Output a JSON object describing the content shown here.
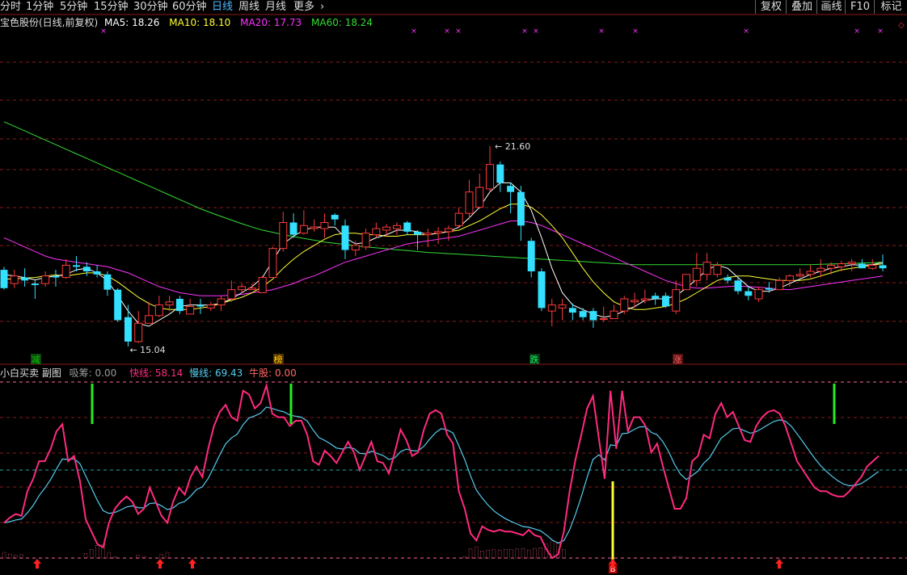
{
  "toolbar": {
    "timeframes": [
      "分时",
      "1分钟",
      "5分钟",
      "15分钟",
      "30分钟",
      "60分钟",
      "日线",
      "周线",
      "月线",
      "更多"
    ],
    "active_timeframe": "日线",
    "more_arrow": "›",
    "right_buttons": [
      "复权",
      "叠加",
      "画线",
      "F10",
      "标记"
    ]
  },
  "ma_header": {
    "name": "宝色股份(日线,前复权)",
    "ma5": "MA5: 18.26",
    "ma10": "MA10: 18.10",
    "ma20": "MA20: 17.73",
    "ma60": "MA60: 18.24"
  },
  "colors": {
    "up": "#ff3b3b",
    "down": "#33e0ff",
    "ma5": "#ffffff",
    "ma10": "#ffff33",
    "ma20": "#ff33ff",
    "ma60": "#33dd33",
    "fast": "#ff2a7f",
    "slow": "#55ccee",
    "grid": "#8b1a1a"
  },
  "price_labels": {
    "high": "21.60",
    "low": "15.04"
  },
  "signals": [
    {
      "text": "减",
      "color": "#00cc00",
      "bg": "#114411",
      "pos": 44
    },
    {
      "text": "榜",
      "color": "#ffcc00",
      "bg": "#553300",
      "pos": 344
    },
    {
      "text": "跌",
      "color": "#00ff66",
      "bg": "#113311",
      "pos": 661
    },
    {
      "text": "涨",
      "color": "#ff6666",
      "bg": "#551111",
      "pos": 838
    }
  ],
  "indicator_header": {
    "name": "小白买卖 副图",
    "suck": "吸筹: 0.00",
    "fast": "快线: 58.14",
    "slow": "慢线: 69.43",
    "bull": "牛股: 0.00"
  },
  "buy_marker": "B",
  "chart_data": {
    "type": "candlestick",
    "candles": [
      [
        17.55,
        16.95,
        17.65,
        16.9
      ],
      [
        17.1,
        17.35,
        17.55,
        16.95
      ],
      [
        17.3,
        17.2,
        17.6,
        17.0
      ],
      [
        17.1,
        17.05,
        17.2,
        16.6
      ],
      [
        17.1,
        17.35,
        17.5,
        17.0
      ],
      [
        17.35,
        17.3,
        17.55,
        17.0
      ],
      [
        17.3,
        17.7,
        17.9,
        17.25
      ],
      [
        17.7,
        17.65,
        18.0,
        17.5
      ],
      [
        17.65,
        17.5,
        17.8,
        17.35
      ],
      [
        17.5,
        17.4,
        17.7,
        17.3
      ],
      [
        17.4,
        16.9,
        17.5,
        16.7
      ],
      [
        16.9,
        15.9,
        16.95,
        15.85
      ],
      [
        16.0,
        15.2,
        16.4,
        15.04
      ],
      [
        15.2,
        15.8,
        16.2,
        15.15
      ],
      [
        15.8,
        16.05,
        16.5,
        15.8
      ],
      [
        16.05,
        16.4,
        16.7,
        16.0
      ],
      [
        16.4,
        16.5,
        16.7,
        16.2
      ],
      [
        16.6,
        16.2,
        16.7,
        16.1
      ],
      [
        16.1,
        16.35,
        16.6,
        16.1
      ],
      [
        16.4,
        16.35,
        16.6,
        16.1
      ],
      [
        16.3,
        16.4,
        16.5,
        16.2
      ],
      [
        16.4,
        16.6,
        16.7,
        16.2
      ],
      [
        16.6,
        16.9,
        17.2,
        16.5
      ],
      [
        16.9,
        17.0,
        17.1,
        16.8
      ],
      [
        16.9,
        16.95,
        17.1,
        16.9
      ],
      [
        16.8,
        17.3,
        17.35,
        16.8
      ],
      [
        17.3,
        18.25,
        18.3,
        17.3
      ],
      [
        18.25,
        19.1,
        19.45,
        18.15
      ],
      [
        19.1,
        18.7,
        19.4,
        18.6
      ],
      [
        18.75,
        19.0,
        19.5,
        18.7
      ],
      [
        18.9,
        18.95,
        19.2,
        18.8
      ],
      [
        18.9,
        19.1,
        19.4,
        18.6
      ],
      [
        19.35,
        19.2,
        19.4,
        19.0
      ],
      [
        19.0,
        18.2,
        19.2,
        17.9
      ],
      [
        18.2,
        18.35,
        18.5,
        18.0
      ],
      [
        18.3,
        18.75,
        18.9,
        18.2
      ],
      [
        18.7,
        18.9,
        19.1,
        18.6
      ],
      [
        18.85,
        18.95,
        19.05,
        18.65
      ],
      [
        18.9,
        19.0,
        19.1,
        18.7
      ],
      [
        19.1,
        18.8,
        19.15,
        18.7
      ],
      [
        18.8,
        18.7,
        18.85,
        18.2
      ],
      [
        18.7,
        18.75,
        18.9,
        18.3
      ],
      [
        18.75,
        18.8,
        18.95,
        18.4
      ],
      [
        18.8,
        18.9,
        19.0,
        18.5
      ],
      [
        19.0,
        19.4,
        19.6,
        18.95
      ],
      [
        19.4,
        20.1,
        20.5,
        19.2
      ],
      [
        19.6,
        20.25,
        20.7,
        19.55
      ],
      [
        20.2,
        21.0,
        21.6,
        20.1
      ],
      [
        21.0,
        20.4,
        21.1,
        20.1
      ],
      [
        20.3,
        20.1,
        20.4,
        19.4
      ],
      [
        20.1,
        19.0,
        20.3,
        18.5
      ],
      [
        18.5,
        17.5,
        18.6,
        17.3
      ],
      [
        17.5,
        16.3,
        17.6,
        16.2
      ],
      [
        16.2,
        16.4,
        16.6,
        15.7
      ],
      [
        16.3,
        16.4,
        16.6,
        15.9
      ],
      [
        16.3,
        16.15,
        16.45,
        15.9
      ],
      [
        16.2,
        16.0,
        16.3,
        15.9
      ],
      [
        16.2,
        15.9,
        16.3,
        15.65
      ],
      [
        15.95,
        15.95,
        16.35,
        15.85
      ],
      [
        15.95,
        16.2,
        16.4,
        15.95
      ],
      [
        16.2,
        16.6,
        16.7,
        16.1
      ],
      [
        16.5,
        16.55,
        16.8,
        16.3
      ],
      [
        16.55,
        16.6,
        16.9,
        16.45
      ],
      [
        16.7,
        16.6,
        16.8,
        16.4
      ],
      [
        16.7,
        16.35,
        16.8,
        16.3
      ],
      [
        16.2,
        16.9,
        17.2,
        16.1
      ],
      [
        16.9,
        17.4,
        17.4,
        16.9
      ],
      [
        17.2,
        17.6,
        18.1,
        17.0
      ],
      [
        17.4,
        17.8,
        18.1,
        17.2
      ],
      [
        17.4,
        17.7,
        17.8,
        17.3
      ],
      [
        17.3,
        17.2,
        17.4,
        17.1
      ],
      [
        17.2,
        16.85,
        17.3,
        16.75
      ],
      [
        16.85,
        16.7,
        17.0,
        16.55
      ],
      [
        16.6,
        16.9,
        17.0,
        16.5
      ],
      [
        16.95,
        16.9,
        17.15,
        16.8
      ],
      [
        16.9,
        17.2,
        17.3,
        16.9
      ],
      [
        17.2,
        17.35,
        17.4,
        17.0
      ],
      [
        17.35,
        17.4,
        17.6,
        17.3
      ],
      [
        17.4,
        17.5,
        17.7,
        17.3
      ],
      [
        17.5,
        17.6,
        17.9,
        17.3
      ],
      [
        17.6,
        17.7,
        17.8,
        17.4
      ],
      [
        17.65,
        17.75,
        17.85,
        17.5
      ],
      [
        17.75,
        17.8,
        17.9,
        17.5
      ],
      [
        17.75,
        17.6,
        17.9,
        17.6
      ],
      [
        17.6,
        17.7,
        17.9,
        17.55
      ],
      [
        17.7,
        17.6,
        18.05,
        17.5
      ]
    ],
    "ma5": [
      17.4,
      17.35,
      17.3,
      17.22,
      17.3,
      17.35,
      17.4,
      17.55,
      17.6,
      17.45,
      17.2,
      16.7,
      16.2,
      15.8,
      15.7,
      15.9,
      16.1,
      16.35,
      16.4,
      16.4,
      16.4,
      16.45,
      16.6,
      16.8,
      17.0,
      17.3,
      17.85,
      18.4,
      18.65,
      18.85,
      18.95,
      18.95,
      18.95,
      18.6,
      18.4,
      18.45,
      18.6,
      18.7,
      18.85,
      18.85,
      18.8,
      18.7,
      18.75,
      18.8,
      18.95,
      19.25,
      19.6,
      20.1,
      20.4,
      20.4,
      20.1,
      19.5,
      18.6,
      17.6,
      16.8,
      16.4,
      16.25,
      16.1,
      16.0,
      16.05,
      16.2,
      16.35,
      16.55,
      16.6,
      16.6,
      16.7,
      16.95,
      17.25,
      17.55,
      17.7,
      17.6,
      17.3,
      17.0,
      16.85,
      16.85,
      16.95,
      17.1,
      17.25,
      17.4,
      17.5,
      17.6,
      17.65,
      17.72,
      17.7,
      17.72,
      17.8
    ],
    "ma10": [
      17.25,
      17.25,
      17.28,
      17.3,
      17.35,
      17.38,
      17.35,
      17.4,
      17.45,
      17.45,
      17.35,
      17.15,
      16.9,
      16.65,
      16.45,
      16.3,
      16.25,
      16.25,
      16.25,
      16.3,
      16.35,
      16.45,
      16.55,
      16.65,
      16.8,
      17.0,
      17.25,
      17.6,
      17.9,
      18.15,
      18.35,
      18.55,
      18.7,
      18.75,
      18.75,
      18.7,
      18.7,
      18.65,
      18.65,
      18.7,
      18.7,
      18.7,
      18.75,
      18.8,
      18.85,
      19.0,
      19.15,
      19.35,
      19.55,
      19.7,
      19.7,
      19.6,
      19.35,
      19.0,
      18.6,
      18.1,
      17.6,
      17.15,
      16.8,
      16.5,
      16.35,
      16.25,
      16.25,
      16.3,
      16.35,
      16.45,
      16.6,
      16.8,
      17.0,
      17.2,
      17.3,
      17.35,
      17.35,
      17.3,
      17.25,
      17.2,
      17.2,
      17.2,
      17.25,
      17.35,
      17.45,
      17.55,
      17.6,
      17.65,
      17.7,
      17.75
    ],
    "ma20": [
      18.6,
      18.45,
      18.3,
      18.15,
      18.0,
      17.9,
      17.85,
      17.8,
      17.75,
      17.7,
      17.65,
      17.55,
      17.45,
      17.3,
      17.15,
      17.0,
      16.9,
      16.8,
      16.75,
      16.7,
      16.7,
      16.7,
      16.72,
      16.75,
      16.8,
      16.85,
      16.9,
      17.0,
      17.1,
      17.25,
      17.35,
      17.5,
      17.65,
      17.8,
      17.9,
      18.0,
      18.1,
      18.2,
      18.3,
      18.4,
      18.45,
      18.5,
      18.55,
      18.6,
      18.65,
      18.75,
      18.85,
      18.95,
      19.05,
      19.15,
      19.15,
      19.1,
      19.0,
      18.85,
      18.7,
      18.55,
      18.4,
      18.25,
      18.1,
      17.95,
      17.8,
      17.65,
      17.5,
      17.35,
      17.2,
      17.1,
      17.0,
      16.95,
      16.95,
      16.98,
      17.0,
      17.02,
      17.0,
      16.98,
      16.95,
      16.92,
      16.9,
      16.95,
      17.0,
      17.05,
      17.1,
      17.15,
      17.2,
      17.25,
      17.3,
      17.35
    ],
    "ma60": [
      22.4,
      22.25,
      22.1,
      21.95,
      21.8,
      21.65,
      21.5,
      21.35,
      21.2,
      21.05,
      20.9,
      20.75,
      20.6,
      20.45,
      20.3,
      20.15,
      20.0,
      19.85,
      19.7,
      19.55,
      19.42,
      19.3,
      19.18,
      19.06,
      18.95,
      18.85,
      18.78,
      18.7,
      18.64,
      18.58,
      18.52,
      18.46,
      18.42,
      18.38,
      18.34,
      18.3,
      18.27,
      18.24,
      18.21,
      18.18,
      18.15,
      18.12,
      18.1,
      18.08,
      18.06,
      18.04,
      18.02,
      18.0,
      17.98,
      17.96,
      17.94,
      17.92,
      17.9,
      17.88,
      17.86,
      17.84,
      17.82,
      17.8,
      17.78,
      17.76,
      17.74,
      17.72,
      17.72,
      17.72,
      17.72,
      17.72,
      17.72,
      17.72,
      17.72,
      17.72,
      17.72,
      17.72,
      17.72,
      17.72,
      17.72,
      17.72,
      17.72,
      17.72,
      17.72,
      17.73,
      17.74,
      17.75,
      17.76,
      17.77,
      17.78,
      17.8
    ],
    "fast": [
      20,
      23,
      25,
      24,
      38,
      45,
      55,
      55,
      62,
      72,
      76,
      55,
      58,
      44,
      22,
      15,
      8,
      6,
      20,
      28,
      32,
      35,
      32,
      25,
      28,
      40,
      32,
      24,
      20,
      32,
      40,
      36,
      46,
      52,
      46,
      62,
      75,
      83,
      87,
      80,
      78,
      95,
      93,
      85,
      88,
      98,
      82,
      80,
      80,
      75,
      78,
      78,
      70,
      55,
      53,
      61,
      58,
      54,
      60,
      66,
      60,
      50,
      58,
      66,
      55,
      54,
      48,
      60,
      73,
      67,
      58,
      60,
      73,
      82,
      84,
      82,
      70,
      65,
      38,
      28,
      14,
      10,
      18,
      16,
      15,
      16,
      15,
      15,
      14,
      13,
      16,
      13,
      12,
      5,
      0,
      2,
      15,
      38,
      56,
      70,
      85,
      92,
      68,
      45,
      95,
      62,
      95,
      72,
      80,
      80,
      75,
      60,
      65,
      52,
      40,
      28,
      28,
      34,
      55,
      58,
      70,
      68,
      82,
      88,
      80,
      83,
      75,
      67,
      66,
      75,
      80,
      83,
      84,
      82,
      75,
      65,
      55,
      50,
      45,
      40,
      38,
      38,
      36,
      35,
      35,
      38,
      42,
      46,
      52,
      55,
      58
    ]
  }
}
